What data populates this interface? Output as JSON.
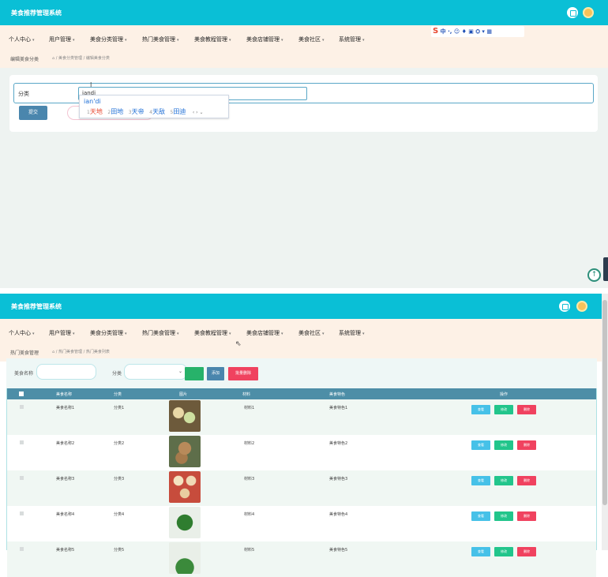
{
  "app": {
    "title": "美食推荐管理系统"
  },
  "nav": [
    {
      "label": "个人中心"
    },
    {
      "label": "用户管理"
    },
    {
      "label": "美食分类管理"
    },
    {
      "label": "热门美食管理"
    },
    {
      "label": "美食教程管理"
    },
    {
      "label": "美食店铺管理"
    },
    {
      "label": "美食社区"
    },
    {
      "label": "系统管理"
    }
  ],
  "top_frame": {
    "breadcrumb_title": "编辑美食分类",
    "breadcrumb_path": "⌂ / 美食分类管理 / 编辑美食分类",
    "form": {
      "field_label": "分类",
      "field_value": "iandi",
      "submit_label": "提交"
    },
    "ime": {
      "pinyin": "ian'di",
      "candidates": [
        {
          "num": "1",
          "text": "天地"
        },
        {
          "num": "2",
          "text": "田地"
        },
        {
          "num": "3",
          "text": "天帝"
        },
        {
          "num": "4",
          "text": "天敌"
        },
        {
          "num": "5",
          "text": "田迪"
        }
      ],
      "nav_text": "‹ › ⌄"
    },
    "sogou_toolbar": "中 ·, ☺ ♦ ▣ ⛭ ▾ ▦"
  },
  "bottom_frame": {
    "breadcrumb_title": "热门美食管理",
    "breadcrumb_path": "⌂ / 热门美食管理 / 热门美食列表",
    "search": {
      "name_label": "美食名称",
      "category_label": "分类",
      "search_button": "",
      "add_button": "添加",
      "batch_delete_button": "批量删除"
    },
    "table": {
      "headers": [
        "美食名称",
        "分类",
        "图片",
        "材料",
        "美食特色",
        "操作"
      ],
      "rows": [
        {
          "name": "美食名称1",
          "category": "分类1",
          "material": "材料1",
          "feature": "美食特色1",
          "thumb": "a"
        },
        {
          "name": "美食名称2",
          "category": "分类2",
          "material": "材料2",
          "feature": "美食特色2",
          "thumb": "b"
        },
        {
          "name": "美食名称3",
          "category": "分类3",
          "material": "材料3",
          "feature": "美食特色3",
          "thumb": "c"
        },
        {
          "name": "美食名称4",
          "category": "分类4",
          "material": "材料4",
          "feature": "美食特色4",
          "thumb": "d"
        },
        {
          "name": "美食名称5",
          "category": "分类5",
          "material": "材料5",
          "feature": "美食特色5",
          "thumb": "e"
        }
      ],
      "actions": {
        "view": "查看",
        "edit": "修改",
        "delete": "删除"
      }
    }
  },
  "colors": {
    "topbar": "#0abfd6",
    "navbar": "#fdf1e6",
    "submit": "#4a86ad",
    "table_header": "#4d8ea7",
    "view": "#46c1e8",
    "edit": "#22c58b",
    "delete": "#f0425f"
  }
}
